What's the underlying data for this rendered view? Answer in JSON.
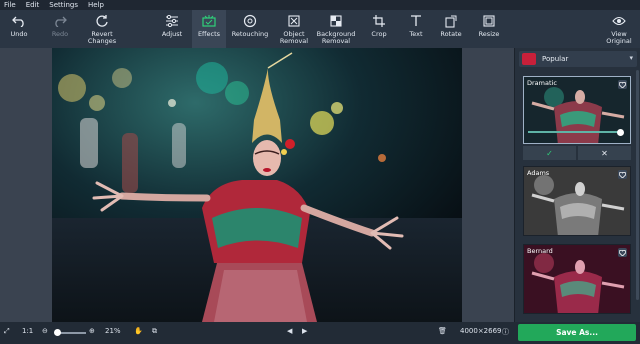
{
  "menu": [
    "File",
    "Edit",
    "Settings",
    "Help"
  ],
  "toolbar": {
    "undo": "Undo",
    "redo": "Redo",
    "revert": "Revert\nChanges",
    "adjust": "Adjust",
    "effects": "Effects",
    "retouching": "Retouching",
    "object_removal": "Object\nRemoval",
    "background_removal": "Background\nRemoval",
    "crop": "Crop",
    "text": "Text",
    "rotate": "Rotate",
    "resize": "Resize",
    "view_original": "View\nOriginal"
  },
  "panel": {
    "category": "Popular",
    "effects": [
      "Dramatic",
      "Adams",
      "Bernard"
    ]
  },
  "bottom": {
    "zoom": "21%",
    "ratio": "1:1",
    "dimensions": "4000×2669",
    "save": "Save As..."
  },
  "colors": {
    "accent": "#22a85a",
    "toolbar": "#2b3644",
    "panel": "#27313d"
  }
}
